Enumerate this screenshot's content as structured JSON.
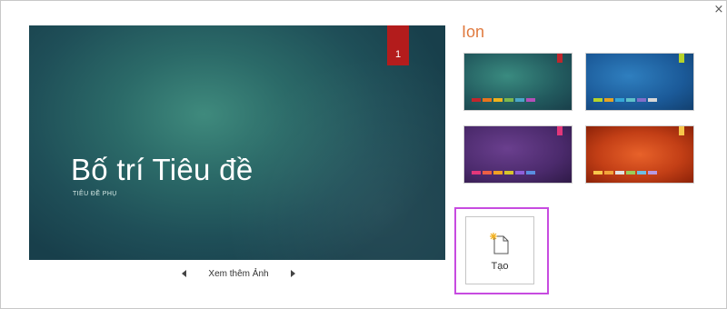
{
  "dialog": {
    "close_glyph": "×"
  },
  "preview": {
    "slide_number": "1",
    "title": "Bố trí Tiêu đề",
    "subtitle": "TIÊU ĐỀ PHỤ"
  },
  "nav": {
    "more_images_label": "Xem thêm Ảnh"
  },
  "theme": {
    "name": "Ion",
    "name_color": "#e07a3f"
  },
  "variants": [
    {
      "name": "teal",
      "tag_color": "#c0262d",
      "chips": [
        "#c0262d",
        "#e8741d",
        "#f0b21c",
        "#7db84d",
        "#4aa6c9",
        "#b44fb8"
      ]
    },
    {
      "name": "blue",
      "tag_color": "#b6d32a",
      "chips": [
        "#b6d32a",
        "#e5a223",
        "#34a7d8",
        "#5ec0c9",
        "#7f6ec9",
        "#d7d7d7"
      ]
    },
    {
      "name": "purple",
      "tag_color": "#e3377a",
      "chips": [
        "#e3377a",
        "#ec5f45",
        "#f0a024",
        "#d6c52c",
        "#8f5fd9",
        "#5a8ee0"
      ]
    },
    {
      "name": "orange",
      "tag_color": "#f7c64a",
      "chips": [
        "#f7c64a",
        "#f2a53a",
        "#e2e2e2",
        "#9acd5a",
        "#6fbde4",
        "#b89ae0"
      ]
    }
  ],
  "create": {
    "label": "Tạo",
    "highlight_color": "#c74be0"
  }
}
